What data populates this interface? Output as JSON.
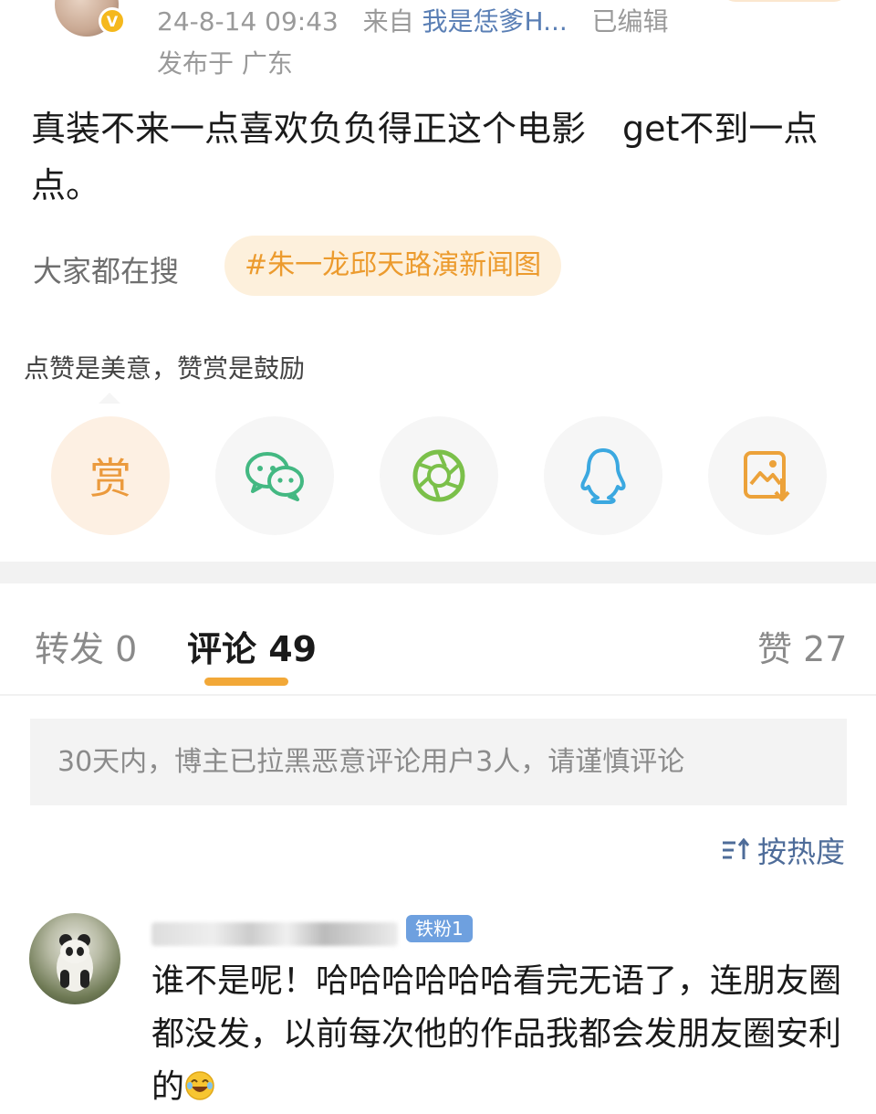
{
  "post": {
    "date": "24-8-14 09:43",
    "from_prefix": "来自",
    "source": "我是恁爹H...",
    "edited": "已编辑",
    "location": "发布于 广东",
    "text_part1": "真装不来一点喜欢负负得正这个电影",
    "text_part2": "get不到一点点。"
  },
  "search": {
    "label": "大家都在搜",
    "tag": "#朱一龙邱天路演新闻图"
  },
  "reward": {
    "tip": "点赞是美意，赞赏是鼓励",
    "button_label": "赏"
  },
  "share_icons": [
    "reward-icon",
    "wechat-icon",
    "moments-icon",
    "qq-icon",
    "save-image-icon"
  ],
  "tabs": {
    "repost": "转发 0",
    "comments": "评论 49",
    "likes": "赞 27"
  },
  "notice": "30天内，博主已拉黑恶意评论用户3人，请谨慎评论",
  "sort_label": "按热度",
  "comment": {
    "badge": "铁粉1",
    "text": "谁不是呢！哈哈哈哈哈哈看完无语了，连朋友圈都没发，以前每次他的作品我都会发朋友圈安利的"
  },
  "colors": {
    "accent_orange": "#f2a838",
    "link_blue": "#5a7fb5",
    "wechat_green": "#43b882",
    "qq_blue": "#3ba8e0"
  }
}
